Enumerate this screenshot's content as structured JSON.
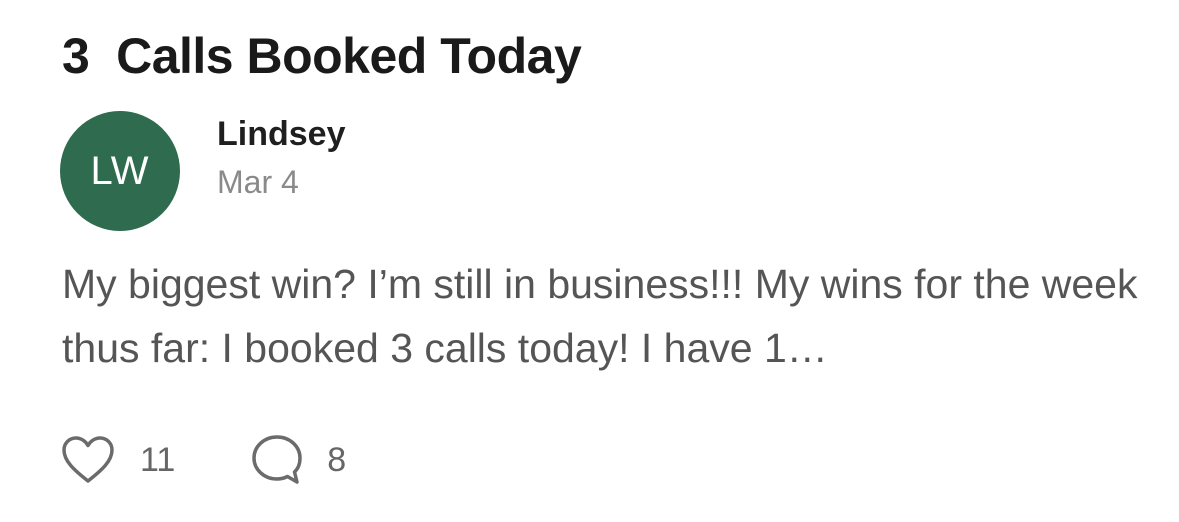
{
  "post": {
    "title": "3  Calls Booked Today",
    "author": {
      "initials": "LW",
      "name": "Lindsey",
      "avatar_color": "#2f6b4f"
    },
    "date": "Mar 4",
    "excerpt": "My biggest win? I’m still in business!!! My wins for the week thus far: I booked 3 calls today! I have 1…",
    "likes": {
      "icon": "heart-outline-icon",
      "count": "11"
    },
    "comments": {
      "icon": "speech-bubble-icon",
      "count": "8"
    }
  },
  "colors": {
    "title": "#1a1a1a",
    "body_text": "#555555",
    "meta_text": "#8a8a8a",
    "icon_stroke": "#6b6b6b"
  }
}
